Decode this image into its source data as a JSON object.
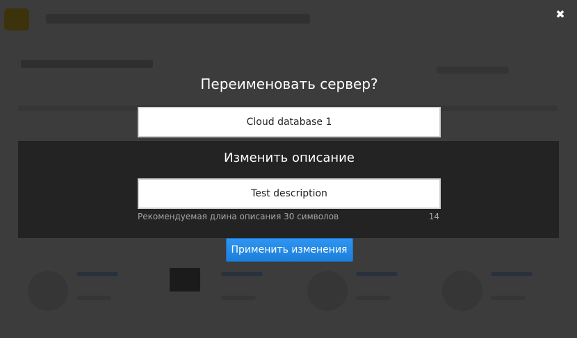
{
  "modal": {
    "title": "Переименовать сервер?",
    "name_value": "Cloud database 1",
    "subtitle": "Изменить описание",
    "description_value": "Test description",
    "hint_text": "Рекомендуемая длина описания 30 символов",
    "char_count": "14",
    "apply_label": "Применить изменения",
    "close_symbol": "✖"
  },
  "colors": {
    "overlay": "#101010",
    "apply_button": "#2489e6",
    "hint_text": "#a6a6a6"
  }
}
